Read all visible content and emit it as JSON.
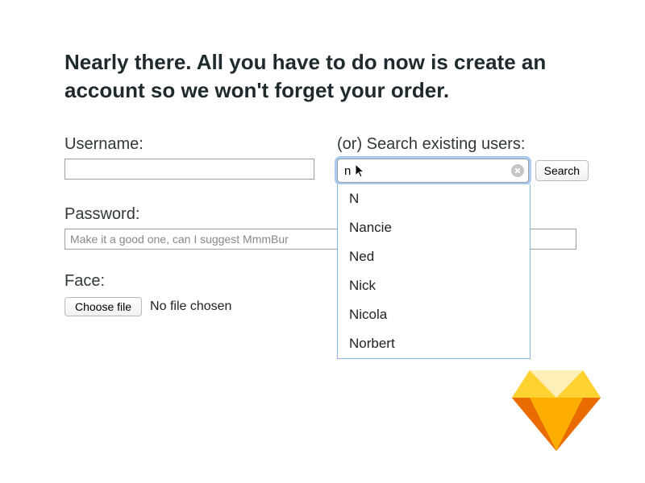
{
  "heading": "Nearly there. All you have to do now is create an account so we won't forget your order.",
  "username": {
    "label": "Username:"
  },
  "search": {
    "label": "(or) Search existing users:",
    "value": "n",
    "button": "Search",
    "suggestions": [
      "N",
      "Nancie",
      "Ned",
      "Nick",
      "Nicola",
      "Norbert"
    ]
  },
  "password": {
    "label": "Password:",
    "placeholder": "Make it a good one, can I suggest MmmBur"
  },
  "face": {
    "label": "Face:",
    "choose": "Choose file",
    "status": "No file chosen"
  }
}
